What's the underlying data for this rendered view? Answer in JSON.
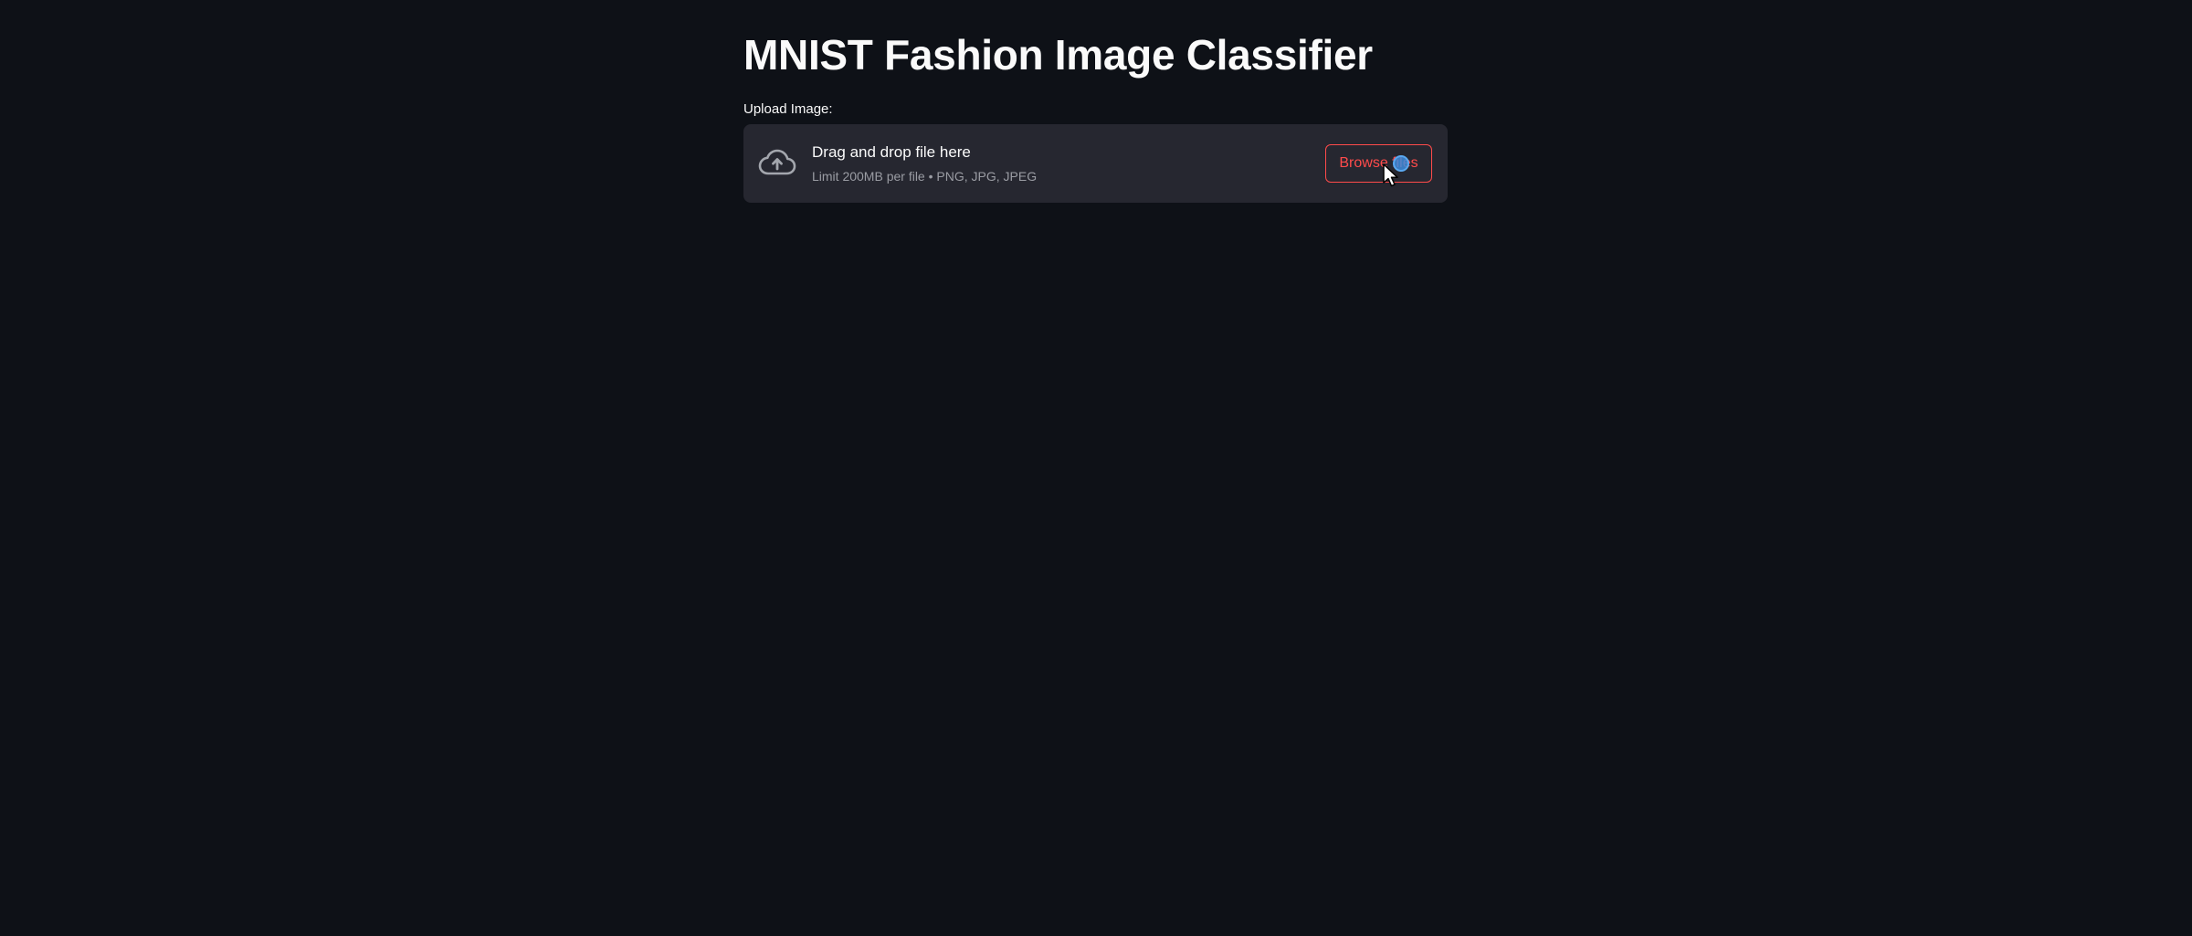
{
  "page": {
    "title": "MNIST Fashion Image Classifier"
  },
  "uploader": {
    "label": "Upload Image:",
    "drop_title": "Drag and drop file here",
    "limit_text": "Limit 200MB per file • PNG, JPG, JPEG",
    "browse_label": "Browse files",
    "icon": "cloud-upload-icon"
  },
  "colors": {
    "background": "#0e1117",
    "dropzone": "#262730",
    "accent": "#ff4b4b",
    "text": "#fafafa",
    "muted_text": "#9a9ca3"
  },
  "cursor": {
    "icon": "arrow-cursor-icon"
  }
}
